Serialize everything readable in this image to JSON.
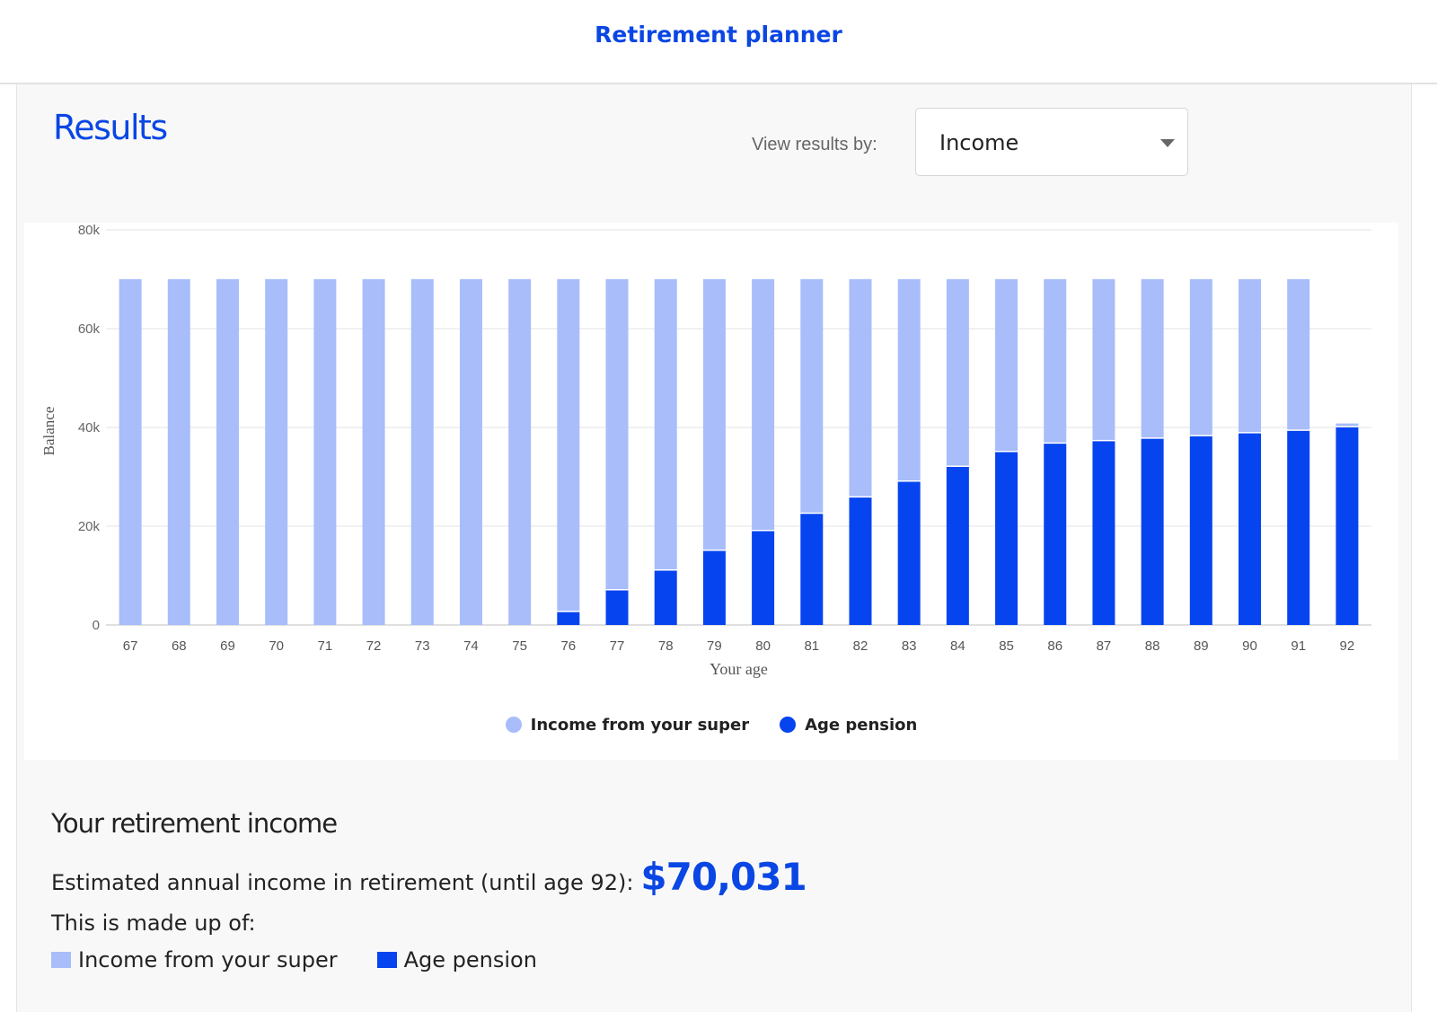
{
  "header": {
    "title": "Retirement planner"
  },
  "results": {
    "title": "Results",
    "view_label": "View results by:",
    "view_selected": "Income"
  },
  "colors": {
    "super": "#a8bdfa",
    "pension": "#0644f0",
    "accent": "#0a46e4"
  },
  "legend": {
    "super": "Income from your super",
    "pension": "Age pension"
  },
  "chart_data": {
    "type": "bar",
    "stacked": true,
    "xlabel": "Your age",
    "ylabel": "Balance",
    "ylim": [
      0,
      80000
    ],
    "yticks": [
      0,
      20000,
      40000,
      60000,
      80000
    ],
    "ytick_labels": [
      "0",
      "20k",
      "40k",
      "60k",
      "80k"
    ],
    "grid": true,
    "legend_position": "bottom",
    "categories": [
      "67",
      "68",
      "69",
      "70",
      "71",
      "72",
      "73",
      "74",
      "75",
      "76",
      "77",
      "78",
      "79",
      "80",
      "81",
      "82",
      "83",
      "84",
      "85",
      "86",
      "87",
      "88",
      "89",
      "90",
      "91",
      "92"
    ],
    "series": [
      {
        "name": "Age pension",
        "values": [
          0,
          0,
          0,
          0,
          0,
          0,
          0,
          0,
          0,
          2600,
          7000,
          11000,
          15000,
          19000,
          22500,
          25800,
          29000,
          32000,
          35000,
          36700,
          37200,
          37700,
          38200,
          38800,
          39300,
          40000
        ]
      },
      {
        "name": "Income from your super",
        "values": [
          70031,
          70031,
          70031,
          70031,
          70031,
          70031,
          70031,
          70031,
          70031,
          67431,
          63031,
          59031,
          55031,
          51031,
          47531,
          44231,
          41031,
          38031,
          35031,
          33331,
          32831,
          32331,
          31831,
          31231,
          30731,
          800
        ]
      }
    ]
  },
  "summary": {
    "heading": "Your retirement income",
    "estimate_label": "Estimated annual income in retirement (until age 92):",
    "estimate_value": "$70,031",
    "madeup_label": "This is made up of:",
    "super_label": "Income from your super",
    "pension_label": "Age pension"
  }
}
